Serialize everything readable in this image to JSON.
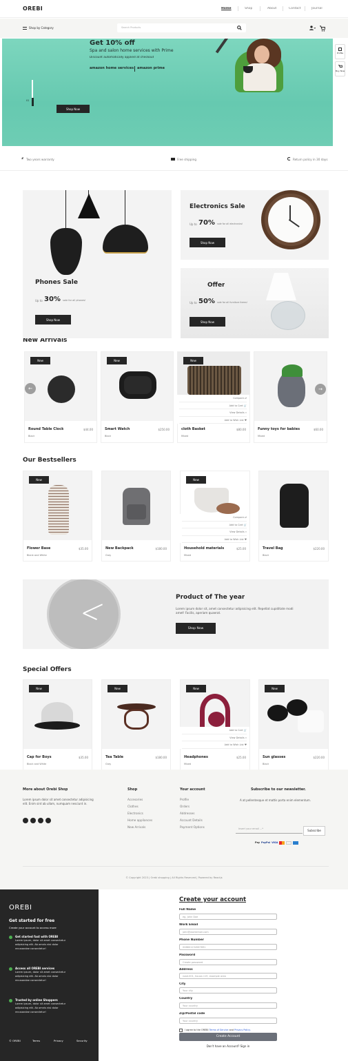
{
  "brand": "OREBI",
  "nav": {
    "items": [
      "Home",
      "Shop",
      "About",
      "Contact",
      "Journal"
    ]
  },
  "header": {
    "category_label": "Shop by Category",
    "search_placeholder": "Search Products"
  },
  "side_tabs": {
    "profile": "Profile",
    "buy_now": "Buy Now"
  },
  "banner": {
    "title": "Get 10% off",
    "subtitle": "Spa and salon home services with Prime",
    "note": "Discount automatically applied at checkout",
    "logo1": "amazon home services",
    "logo2": "amazon prime",
    "slide_num": "01",
    "button": "Shop Now"
  },
  "features": {
    "warranty": "Two years warranty",
    "shipping": "Free shipping",
    "returns": "Return policy in 30 days",
    "warranty_badge": "2"
  },
  "promos": {
    "phones": {
      "title": "Phones Sale",
      "upto": "Up to",
      "pct": "30%",
      "rest": "sale for all phones!",
      "button": "Shop Now"
    },
    "electronics": {
      "title": "Electronics Sale",
      "upto": "Up to",
      "pct": "70%",
      "rest": "sale for all electronics!",
      "button": "Shop Now"
    },
    "offer": {
      "title": "Offer",
      "upto": "Up to",
      "pct": "50%",
      "rest": "sale for all furniture items!",
      "button": "Shop Now"
    }
  },
  "new_arrivals": {
    "title": "New Arrivals",
    "badge": "New",
    "items": [
      {
        "name": "Round Table Clock",
        "price": "$44.00",
        "color": "Black"
      },
      {
        "name": "Smart Watch",
        "price": "$250.00",
        "color": "Black"
      },
      {
        "name": "cloth Basket",
        "price": "$80.00",
        "color": "Mixed"
      },
      {
        "name": "Funny toys for babies",
        "price": "$60.00",
        "color": "Mixed"
      }
    ]
  },
  "hover_menu": {
    "compare": "Compare",
    "add_to_cart": "Add to Cart",
    "view_details": "View Details",
    "add_to_wish": "Add to Wish List"
  },
  "bestsellers": {
    "title": "Our Bestsellers",
    "badge": "New",
    "items": [
      {
        "name": "Flower Base",
        "price": "$35.00",
        "color": "Blank and White"
      },
      {
        "name": "New Backpack",
        "price": "$180.00",
        "color": "Gray"
      },
      {
        "name": "Household materials",
        "price": "$25.00",
        "color": "Mixed"
      },
      {
        "name": "Travel Bag",
        "price": "$220.00",
        "color": "Black"
      }
    ]
  },
  "product_of_year": {
    "title": "Product of The year",
    "text": "Lorem ipsum dolor sit, amet consectetur adipisicing elit. Repellat cupiditate modi amet! Facilis, aperiam quaerat.",
    "button": "Shop Now"
  },
  "special_offers": {
    "title": "Special Offers",
    "badge": "New",
    "items": [
      {
        "name": "Cap for Boys",
        "price": "$35.00",
        "color": "Black and White"
      },
      {
        "name": "Tea Table",
        "price": "$180.00",
        "color": "Gray"
      },
      {
        "name": "Headphones",
        "price": "$25.00",
        "color": "Mixed"
      },
      {
        "name": "Sun glasses",
        "price": "$220.00",
        "color": "Black"
      }
    ]
  },
  "footer": {
    "about_title": "More about Orebi Shop",
    "about_text": "Lorem ipsum dolor sit amet consectetur adipisicing elit. Enim sint ab ullam, numquam nesciunt in.",
    "shop_title": "Shop",
    "shop_links": [
      "Accesories",
      "Clothes",
      "Electronics",
      "Home appliances",
      "New Arrivals"
    ],
    "account_title": "Your account",
    "account_links": [
      "Profile",
      "Orders",
      "Addresses",
      "Account Details",
      "Payment Options"
    ],
    "news_title": "Subscribe to our newsletter.",
    "news_text": "A at pellentesque et mattis porta enim elementum.",
    "email_placeholder": "Insert your email ...*",
    "subscribe": "Subscribe",
    "payments": [
      "Pay",
      "PayPal",
      "VISA",
      "Mastercard",
      "Discover",
      "Amex"
    ],
    "copyright": "Copyright 2023 | Orebi shopping | All Rights Reserved | Powered by Reactjs"
  },
  "signup_side": {
    "brand": "OREBI",
    "heading": "Get started for free",
    "sub": "Create your account to access more",
    "points": [
      {
        "title": "Get started fast with OREBI",
        "text": "Lorem ipsum, dolor sit amet consectetur adipisicing elit. Ab omnis nisi dolor recusandae consectetur!"
      },
      {
        "title": "Access all OREBI services",
        "text": "Lorem ipsum, dolor sit amet consectetur adipisicing elit. Ab omnis nisi dolor recusandae consectetur!"
      },
      {
        "title": "Trusted by online Shoppers",
        "text": "Lorem ipsum, dolor sit amet consectetur adipisicing elit. Ab omnis nisi dolor recusandae consectetur!"
      }
    ],
    "bottom_links": [
      "© OREBI",
      "Terms",
      "Privacy",
      "Security"
    ]
  },
  "signup_form": {
    "title": "Create your account",
    "fields": [
      {
        "label": "Full Name",
        "placeholder": "eg. John Doe"
      },
      {
        "label": "Work Email",
        "placeholder": "john@workemail.com"
      },
      {
        "label": "Phone Number",
        "placeholder": "008801234567891"
      },
      {
        "label": "Password",
        "placeholder": "Create password"
      },
      {
        "label": "Address",
        "placeholder": "road-001, house-115, example area"
      },
      {
        "label": "City",
        "placeholder": "Your city"
      },
      {
        "label": "Country",
        "placeholder": "Your country"
      },
      {
        "label": "Zip/Postal code",
        "placeholder": "Your country"
      }
    ],
    "agree_prefix": "I agree to the OREBI",
    "terms": "Terms of Service",
    "and": "and",
    "privacy": "Privacy Policy.",
    "button": "Create Account",
    "have_account": "Don't have an Account?",
    "sign_in": "Sign in"
  },
  "colors": {
    "accent_teal": "#6ccdb3",
    "dark": "#262626",
    "gray_bg": "#f5f5f3"
  }
}
